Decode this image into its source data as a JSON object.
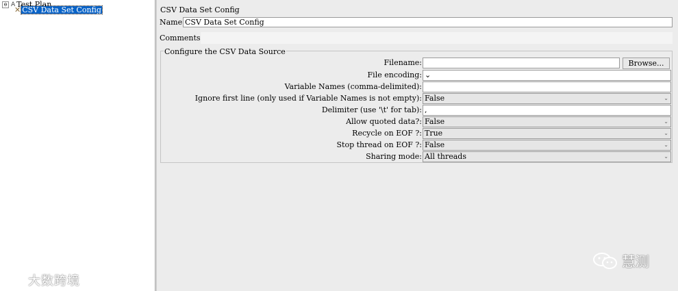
{
  "tree": {
    "root_label": "Test Plan",
    "root_toggle": "⊖",
    "child_label": "CSV Data Set Config"
  },
  "panel": {
    "title": "CSV Data Set Config",
    "name_label": "Name:",
    "name_value": "CSV Data Set Config",
    "comments_label": "Comments:",
    "group_title": "Configure the CSV Data Source",
    "browse_label": "Browse...",
    "fields": [
      {
        "label": "Filename:",
        "value": ""
      },
      {
        "label": "File encoding:",
        "value": ""
      },
      {
        "label": "Variable Names (comma-delimited):",
        "value": ""
      },
      {
        "label": "Ignore first line (only used if Variable Names is not empty):",
        "value": "False"
      },
      {
        "label": "Delimiter (use '\\t' for tab):",
        "value": ","
      },
      {
        "label": "Allow quoted data?:",
        "value": "False"
      },
      {
        "label": "Recycle on EOF ?:",
        "value": "True"
      },
      {
        "label": "Stop thread on EOF ?:",
        "value": "False"
      },
      {
        "label": "Sharing mode:",
        "value": "All threads"
      }
    ]
  },
  "watermarks": {
    "left": "大数跨境",
    "right": "慧测"
  },
  "icons": {
    "dropdown": "⌄",
    "root_icon": "A",
    "config_icon": "✕"
  }
}
